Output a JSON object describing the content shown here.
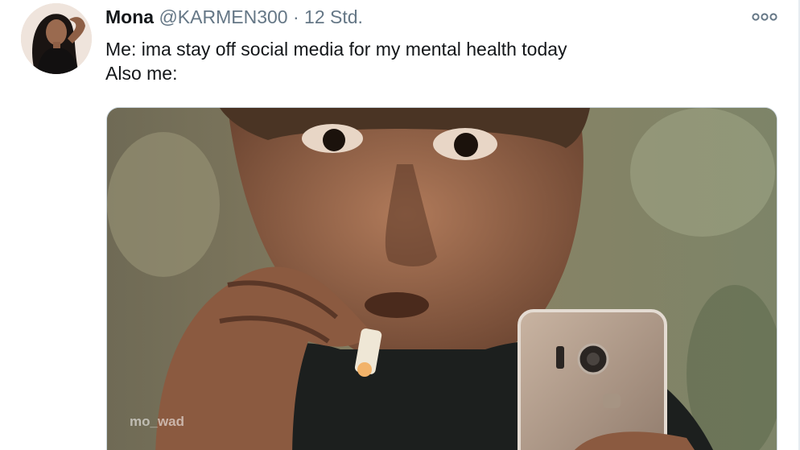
{
  "tweet": {
    "author": {
      "display_name": "Mona",
      "handle": "@KARMEN300"
    },
    "separator": "·",
    "time": "12 Std.",
    "text_lines": [
      "Me: ima stay off social media for my mental health today",
      "Also me:"
    ],
    "media": {
      "watermark": "mo_wad"
    }
  },
  "icons": {
    "more": "more-options-icon",
    "avatar": "avatar"
  }
}
